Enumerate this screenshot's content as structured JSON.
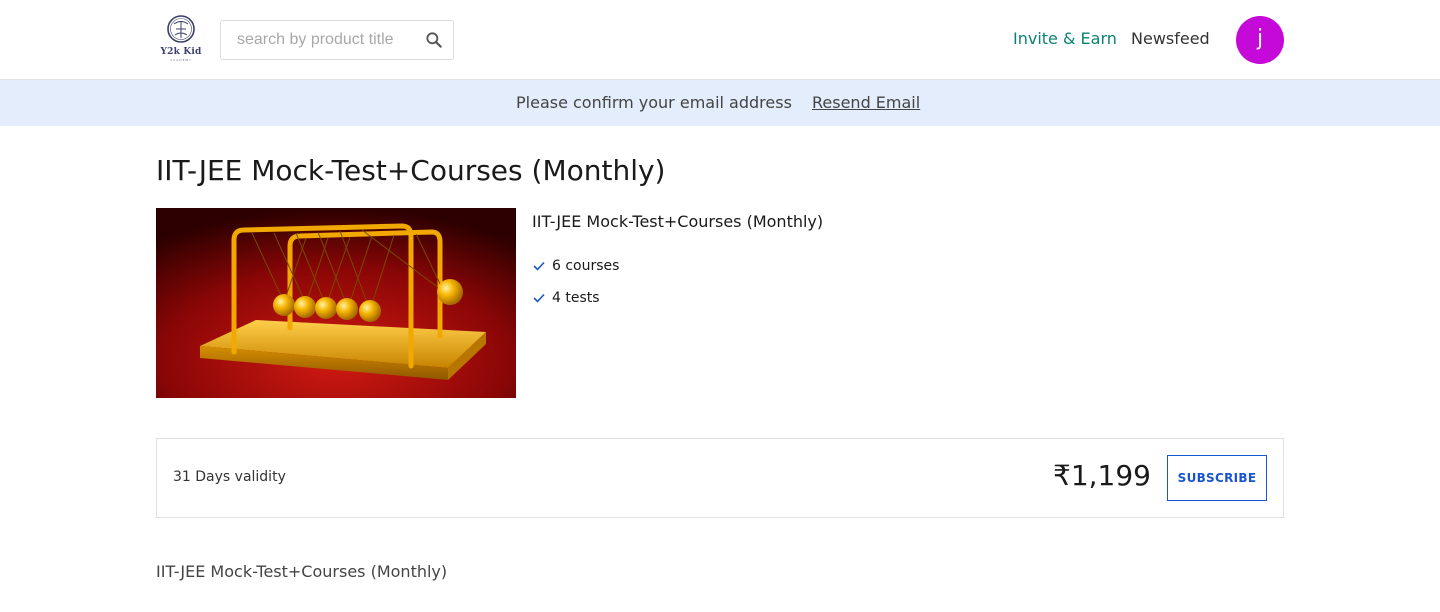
{
  "header": {
    "logo_text": "Y2k Kid",
    "logo_subtext": "ACADEMY",
    "search": {
      "placeholder": "search by product title",
      "value": ""
    },
    "nav": {
      "invite": "Invite & Earn",
      "newsfeed": "Newsfeed"
    },
    "avatar_initial": "j",
    "colors": {
      "invite": "#0d8272",
      "avatar": "#c509d8"
    }
  },
  "banner": {
    "message": "Please confirm your email address",
    "link": "Resend Email",
    "background": "#e3edfb"
  },
  "product": {
    "title": "IIT-JEE Mock-Test+Courses (Monthly)",
    "name": "IIT-JEE Mock-Test+Courses (Monthly)",
    "image_icon": "newtons-cradle-image",
    "features": [
      {
        "icon": "check-icon",
        "text": "6 courses"
      },
      {
        "icon": "check-icon",
        "text": "4 tests"
      }
    ],
    "validity": "31 Days validity",
    "price": "₹1,199",
    "subscribe_label": "SUBSCRIBE",
    "description": "IIT-JEE Mock-Test+Courses (Monthly)",
    "accent": "#1a55d0"
  }
}
